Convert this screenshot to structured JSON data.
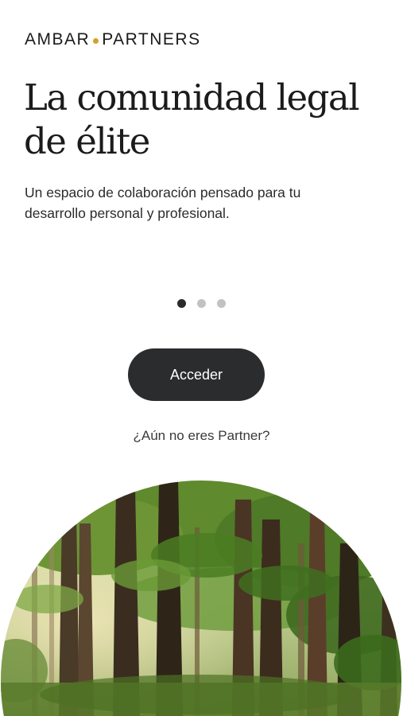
{
  "brand": {
    "name_left": "AMBAR",
    "name_right": "PARTNERS",
    "accent_color": "#d4a02c"
  },
  "hero": {
    "headline_line1": "La comunidad legal",
    "headline_line2": "de élite",
    "subtitle": "Un espacio de colaboración pensado para tu desarrollo personal y profesional."
  },
  "carousel": {
    "total_slides": 3,
    "active_slide": 1
  },
  "actions": {
    "primary_button_label": "Acceder",
    "secondary_link_label": "¿Aún no eres Partner?"
  },
  "colors": {
    "button_bg": "#2b2c2e",
    "text_dark": "#1b1b1b",
    "dot_active": "#2a2a2a",
    "dot_inactive": "#c2c2c2"
  },
  "image": {
    "subject": "forest-trees-circle-image"
  }
}
